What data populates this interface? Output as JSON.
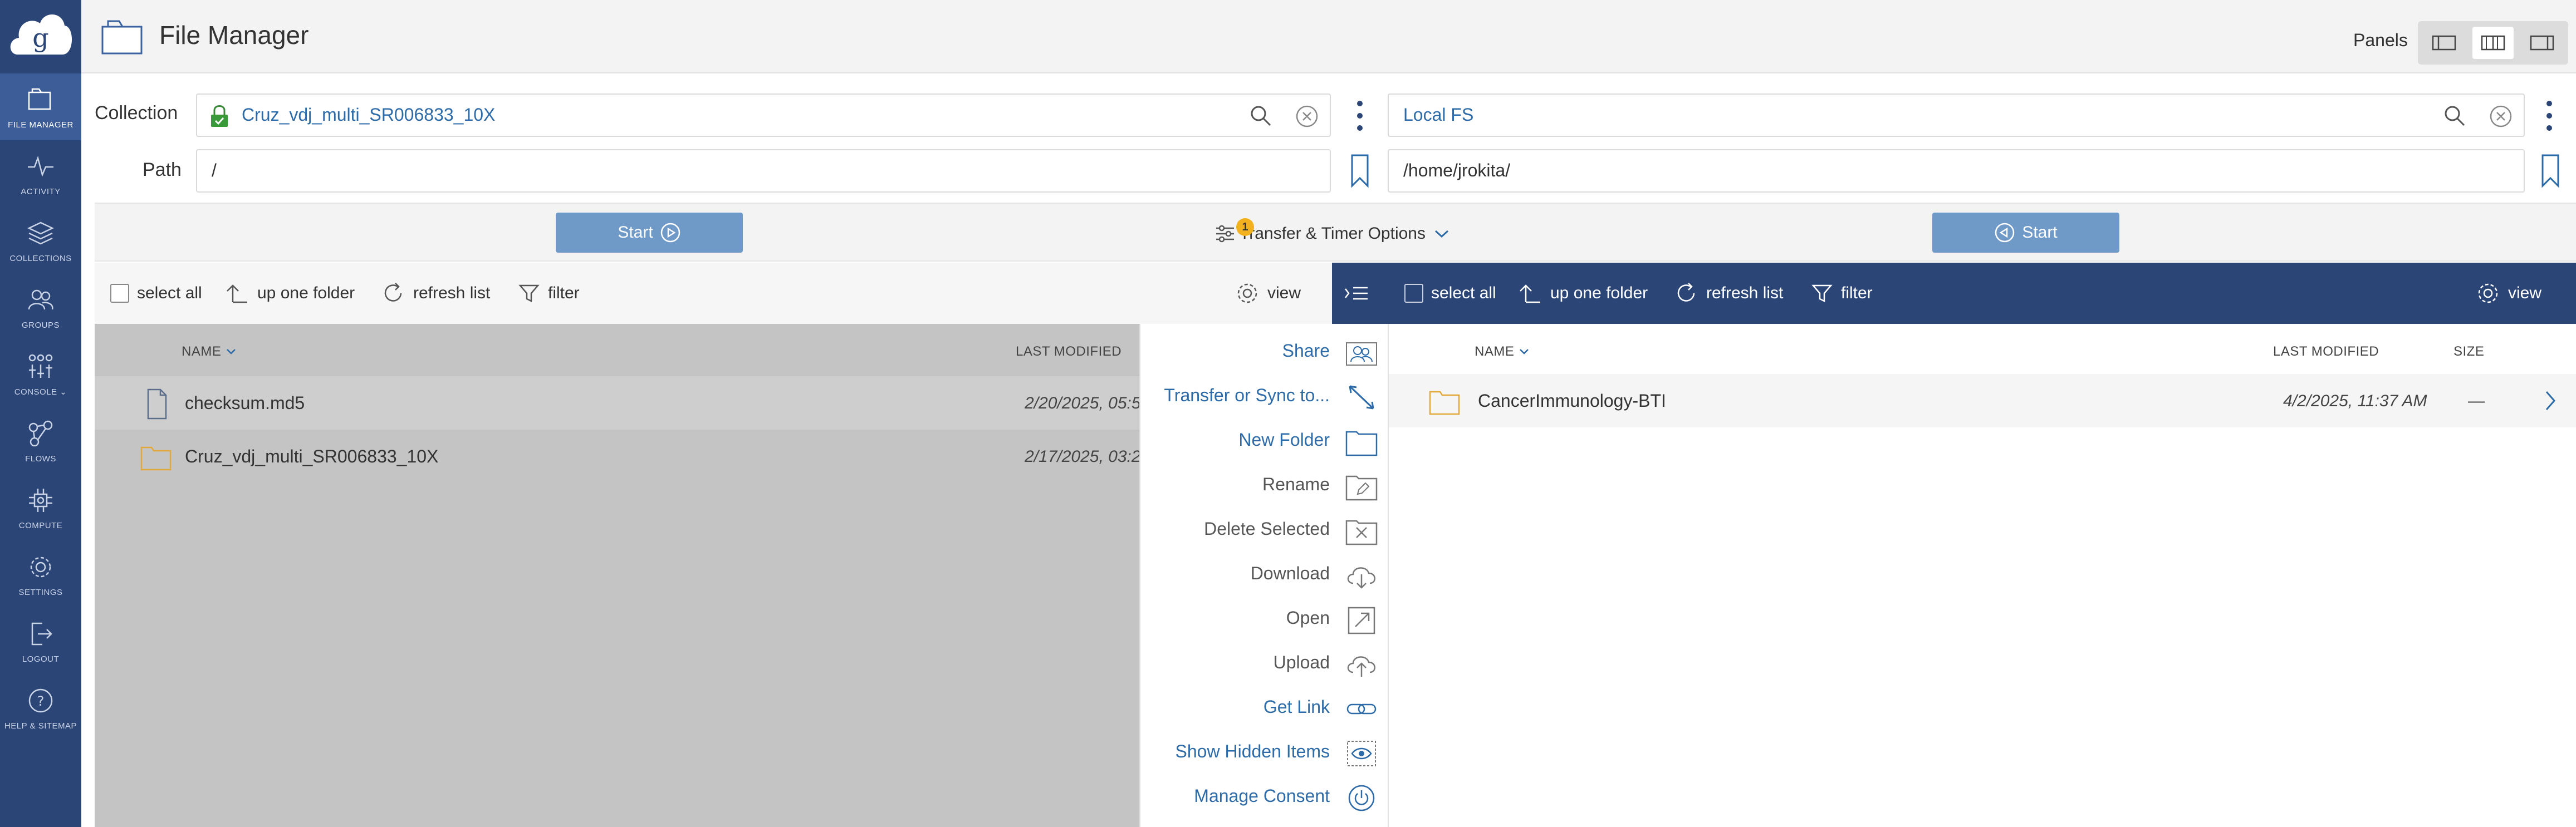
{
  "sidebar": {
    "items": [
      {
        "label": "FILE MANAGER",
        "icon": "file-manager-icon",
        "active": true
      },
      {
        "label": "ACTIVITY",
        "icon": "activity-icon"
      },
      {
        "label": "COLLECTIONS",
        "icon": "collections-icon"
      },
      {
        "label": "GROUPS",
        "icon": "groups-icon"
      },
      {
        "label": "CONSOLE ⌄",
        "icon": "console-icon"
      },
      {
        "label": "FLOWS",
        "icon": "flows-icon"
      },
      {
        "label": "COMPUTE",
        "icon": "compute-icon"
      },
      {
        "label": "SETTINGS",
        "icon": "settings-icon"
      },
      {
        "label": "LOGOUT",
        "icon": "logout-icon"
      },
      {
        "label": "HELP & SITEMAP",
        "icon": "help-icon"
      }
    ]
  },
  "header": {
    "title": "File Manager",
    "panels_label": "Panels"
  },
  "left": {
    "collection_label": "Collection",
    "path_label": "Path",
    "collection": "Cruz_vdj_multi_SR006833_10X",
    "path": "/",
    "start": "Start"
  },
  "right": {
    "collection": "Local FS",
    "path": "/home/jrokita/",
    "start": "Start"
  },
  "transfer": {
    "label": "Transfer & Timer Options",
    "badge": "1"
  },
  "toolbar": {
    "select_all": "select all",
    "up_one_folder": "up one folder",
    "refresh_list": "refresh list",
    "filter": "filter",
    "view": "view"
  },
  "left_list": {
    "columns": {
      "name": "NAME",
      "modified": "LAST MODIFIED"
    },
    "rows": [
      {
        "name": "checksum.md5",
        "modified": "2/20/2025, 05:5",
        "type": "file"
      },
      {
        "name": "Cruz_vdj_multi_SR006833_10X",
        "modified": "2/17/2025, 03:2",
        "type": "folder"
      }
    ]
  },
  "menu": {
    "items": [
      {
        "label": "Share",
        "icon": "share-icon",
        "link": true
      },
      {
        "label": "Transfer or Sync to...",
        "icon": "transfer-icon",
        "link": true
      },
      {
        "label": "New Folder",
        "icon": "new-folder-icon",
        "link": true
      },
      {
        "label": "Rename",
        "icon": "rename-icon",
        "link": false
      },
      {
        "label": "Delete Selected",
        "icon": "delete-icon",
        "link": false
      },
      {
        "label": "Download",
        "icon": "download-icon",
        "link": false
      },
      {
        "label": "Open",
        "icon": "open-icon",
        "link": false
      },
      {
        "label": "Upload",
        "icon": "upload-icon",
        "link": false
      },
      {
        "label": "Get Link",
        "icon": "link-icon",
        "link": true
      },
      {
        "label": "Show Hidden Items",
        "icon": "eye-icon",
        "link": true
      },
      {
        "label": "Manage Consent",
        "icon": "power-icon",
        "link": true
      }
    ]
  },
  "right_list": {
    "columns": {
      "name": "NAME",
      "modified": "LAST MODIFIED",
      "size": "SIZE"
    },
    "rows": [
      {
        "name": "CancerImmunology-BTI",
        "modified": "4/2/2025, 11:37 AM",
        "size": "—",
        "type": "folder"
      }
    ]
  },
  "colors": {
    "sidebar": "#2b4577",
    "accent": "#2c6aa8",
    "start_button": "#6f9ac7",
    "badge": "#f2b21f"
  }
}
